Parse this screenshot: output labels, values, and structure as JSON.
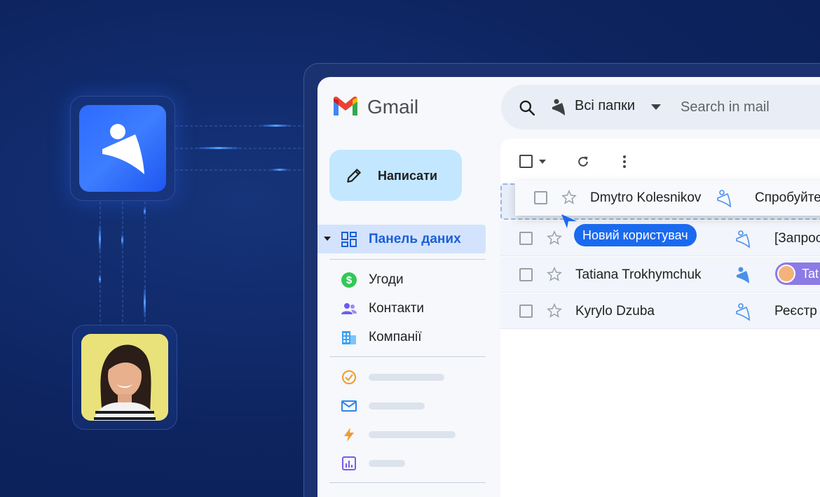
{
  "gmail": {
    "title": "Gmail",
    "search": {
      "folder_label": "Всі папки",
      "placeholder": "Search in mail"
    },
    "compose_label": "Написати",
    "nav": {
      "dashboard": "Панель даних",
      "deals": "Угоди",
      "contacts": "Контакти",
      "companies": "Компанії"
    },
    "dragged_row": {
      "sender": "Dmytro Kolesnikov",
      "subject": "Спробуйте"
    },
    "tooltip": "Новий користувач",
    "rows": [
      {
        "sender": "",
        "subject": "[Запрос"
      },
      {
        "sender": "Tatiana Trokhymchuk",
        "subject": "",
        "chip_label": "Tat"
      },
      {
        "sender": "Kyrylo Dzuba",
        "subject": "Реєстр"
      }
    ]
  },
  "colors": {
    "background": "#0d2460",
    "accent": "#1a6af0",
    "compose": "#c2e7ff",
    "nav_active": "#d3e3fd"
  }
}
